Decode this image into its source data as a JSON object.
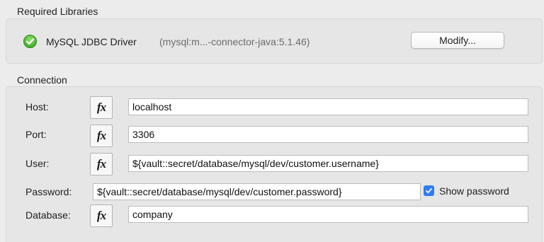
{
  "libraries": {
    "section_title": "Required Libraries",
    "driver_name": "MySQL JDBC Driver",
    "driver_coords": "(mysql:m...-connector-java:5.1.46)",
    "status_icon": "check-circle-icon",
    "modify_label": "Modify..."
  },
  "connection": {
    "section_title": "Connection",
    "fx_label": "fx",
    "host": {
      "label": "Host:",
      "value": "localhost"
    },
    "port": {
      "label": "Port:",
      "value": "3306"
    },
    "user": {
      "label": "User:",
      "value": "${vault::secret/database/mysql/dev/customer.username}"
    },
    "password": {
      "label": "Password:",
      "value": "${vault::secret/database/mysql/dev/customer.password}"
    },
    "show_password": {
      "label": "Show password",
      "checked": true
    },
    "database": {
      "label": "Database:",
      "value": "company"
    }
  },
  "colors": {
    "checkbox_accent": "#2f7cf6",
    "status_green": "#3fae2a"
  }
}
